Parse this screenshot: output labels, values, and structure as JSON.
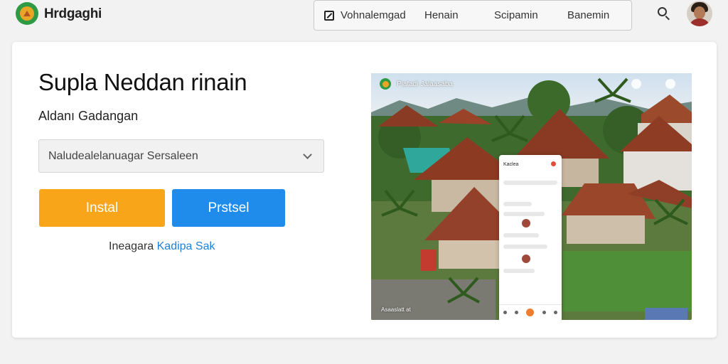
{
  "header": {
    "brand": "Hrdgaghi",
    "nav": [
      {
        "label": "Vohnalemgad",
        "icon": "edit-icon"
      },
      {
        "label": "Henain"
      },
      {
        "label": "Scipamin"
      },
      {
        "label": "Banemin"
      }
    ],
    "search_icon": "search-icon",
    "avatar": "user-avatar"
  },
  "main": {
    "headline": "Supla Neddan rinain",
    "subheadline": "Aldanı Gadangan",
    "select_value": "Naludealelanuagar Sersaleen",
    "install_label": "Instal",
    "secondary_label": "Prstsel",
    "hint_text": "Ineagara",
    "hint_link": "Kadipa Sak"
  },
  "preview": {
    "title": "Piatadi Jalaasaba",
    "caption": "Asaaslatt at",
    "phone_title": "Kaclea"
  },
  "colors": {
    "install": "#f9a51a",
    "secondary": "#1f8ceb",
    "link": "#1f7fd6",
    "brand_green": "#2f9a44"
  }
}
